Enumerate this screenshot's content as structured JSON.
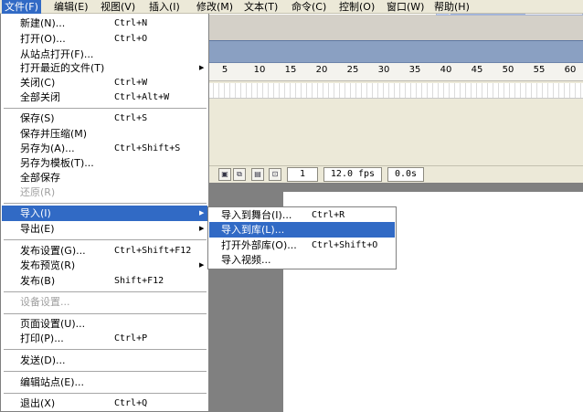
{
  "menubar": [
    {
      "label": "文件(F)",
      "active": true
    },
    {
      "label": "编辑(E)"
    },
    {
      "label": "视图(V)"
    },
    {
      "label": "插入(I)"
    },
    {
      "label": "修改(M)"
    },
    {
      "label": "文本(T)"
    },
    {
      "label": "命令(C)"
    },
    {
      "label": "控制(O)"
    },
    {
      "label": "窗口(W)"
    },
    {
      "label": "帮助(H)"
    }
  ],
  "file_menu": {
    "new": {
      "label": "新建(N)...",
      "shortcut": "Ctrl+N"
    },
    "open": {
      "label": "打开(O)...",
      "shortcut": "Ctrl+O"
    },
    "open_from_site": {
      "label": "从站点打开(F)..."
    },
    "open_recent": {
      "label": "打开最近的文件(T)"
    },
    "close": {
      "label": "关闭(C)",
      "shortcut": "Ctrl+W"
    },
    "close_all": {
      "label": "全部关闭",
      "shortcut": "Ctrl+Alt+W"
    },
    "save": {
      "label": "保存(S)",
      "shortcut": "Ctrl+S"
    },
    "save_compact": {
      "label": "保存并压缩(M)"
    },
    "save_as": {
      "label": "另存为(A)...",
      "shortcut": "Ctrl+Shift+S"
    },
    "save_as_template": {
      "label": "另存为模板(T)..."
    },
    "save_all": {
      "label": "全部保存"
    },
    "revert": {
      "label": "还原(R)"
    },
    "import": {
      "label": "导入(I)"
    },
    "export": {
      "label": "导出(E)"
    },
    "publish_settings": {
      "label": "发布设置(G)...",
      "shortcut": "Ctrl+Shift+F12"
    },
    "publish_preview": {
      "label": "发布预览(R)"
    },
    "publish": {
      "label": "发布(B)",
      "shortcut": "Shift+F12"
    },
    "device_settings": {
      "label": "设备设置..."
    },
    "page_setup": {
      "label": "页面设置(U)..."
    },
    "print": {
      "label": "打印(P)...",
      "shortcut": "Ctrl+P"
    },
    "send": {
      "label": "发送(D)..."
    },
    "edit_sites": {
      "label": "编辑站点(E)..."
    },
    "exit": {
      "label": "退出(X)",
      "shortcut": "Ctrl+Q"
    }
  },
  "import_submenu": {
    "import_to_stage": {
      "label": "导入到舞台(I)...",
      "shortcut": "Ctrl+R"
    },
    "import_to_library": {
      "label": "导入到库(L)..."
    },
    "open_external_library": {
      "label": "打开外部库(O)...",
      "shortcut": "Ctrl+Shift+O"
    },
    "import_video": {
      "label": "导入视频..."
    }
  },
  "timeline": {
    "ruler_ticks": [
      "5",
      "10",
      "15",
      "20",
      "25",
      "30",
      "35",
      "40",
      "45",
      "50",
      "55",
      "60"
    ],
    "current_frame": "1",
    "frame_rate": "12.0 fps",
    "elapsed_time": "0.0s"
  },
  "colors": {
    "menu_highlight": "#316ac5",
    "menubar_bg": "#ece9d8",
    "stage_gray": "#808080"
  }
}
